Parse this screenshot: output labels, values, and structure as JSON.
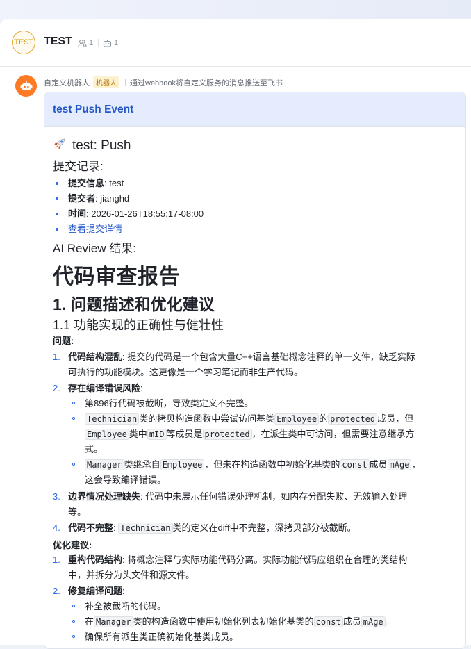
{
  "chat": {
    "avatar_text": "TEST",
    "title": "TEST",
    "member_count": "1",
    "bot_count": "1"
  },
  "message": {
    "sender_name": "自定义机器人",
    "sender_tag": "机器人",
    "sender_desc": "通过webhook将自定义服务的消息推送至飞书",
    "card_title": "test Push Event"
  },
  "content": {
    "push_heading": "test: Push",
    "commits_heading": "提交记录:",
    "commit_items": [
      {
        "label": "提交信息",
        "value": ": test"
      },
      {
        "label": "提交者",
        "value": ": jianghd"
      },
      {
        "label": "时间",
        "value": ": 2026-01-26T18:55:17-08:00"
      }
    ],
    "commit_link": "查看提交详情",
    "review_heading": "AI Review 结果:",
    "report_title": "代码审查报告",
    "section1_title": "1. 问题描述和优化建议",
    "section11_title": "1.1 功能实现的正确性与健壮性",
    "problems_label": "问题:",
    "problems": {
      "p1_num": "1.",
      "p1_label": "代码结构混乱",
      "p1_text_a": ": 提交的代码是一个包含大量C++语言基础概念注释的单一文件，缺乏实际",
      "p1_text_b": "可执行的功能模块。这更像是一个学习笔记而非生产代码。",
      "p2_num": "2.",
      "p2_label": "存在编译错误风险",
      "p2_colon": ":",
      "p2_s1": "第896行代码被截断，导致类定义不完整。",
      "p2_s2": {
        "code1": "Technician",
        "t1": "类的拷贝构造函数中尝试访问基类",
        "code2": "Employee",
        "t2": "的",
        "code3": "protected",
        "t3": "成员，但",
        "code4": "Employee",
        "t4": "类中",
        "code5": "mID",
        "t5": "等成员是",
        "code6": "protected",
        "t6": "，在派生类中可访问，但需要注意继承方",
        "t7": "式。"
      },
      "p2_s3": {
        "code1": "Manager",
        "t1": "类继承自",
        "code2": "Employee",
        "t2": "，但未在构造函数中初始化基类的",
        "code3": "const",
        "t3": "成员",
        "code4": "mAge",
        "t4": "，",
        "t5": "这会导致编译错误。"
      },
      "p3_num": "3.",
      "p3_label": "边界情况处理缺失",
      "p3_text_a": ": 代码中未展示任何错误处理机制，如内存分配失败、无效输入处理",
      "p3_text_b": "等。",
      "p4_num": "4.",
      "p4_label": "代码不完整",
      "p4_colon": ": ",
      "p4_code": "Technician",
      "p4_text": "类的定义在diff中不完整，深拷贝部分被截断。"
    },
    "suggestions_label": "优化建议:",
    "suggestions": {
      "s1_num": "1.",
      "s1_label": "重构代码结构",
      "s1_text_a": ": 将概念注释与实际功能代码分离。实际功能代码应组织在合理的类结构",
      "s1_text_b": "中，并拆分为头文件和源文件。",
      "s2_num": "2.",
      "s2_label": "修复编译问题",
      "s2_colon": ":",
      "s2_a": "补全被截断的代码。",
      "s2_b": {
        "t1": "在",
        "code1": "Manager",
        "t2": "类的构造函数中使用初始化列表初始化基类的",
        "code2": "const",
        "t3": "成员",
        "code3": "mAge",
        "t4": "。"
      },
      "s2_c": "确保所有派生类正确初始化基类成员。"
    }
  },
  "colors": {
    "accent": "#2456c8",
    "card_header_bg": "#e5ecfd",
    "bot_avatar": "#ff7a25",
    "tag_bg": "#fdf2cf"
  },
  "icons": [
    "members-icon",
    "bot-count-icon",
    "robot-icon",
    "rocket-icon"
  ]
}
